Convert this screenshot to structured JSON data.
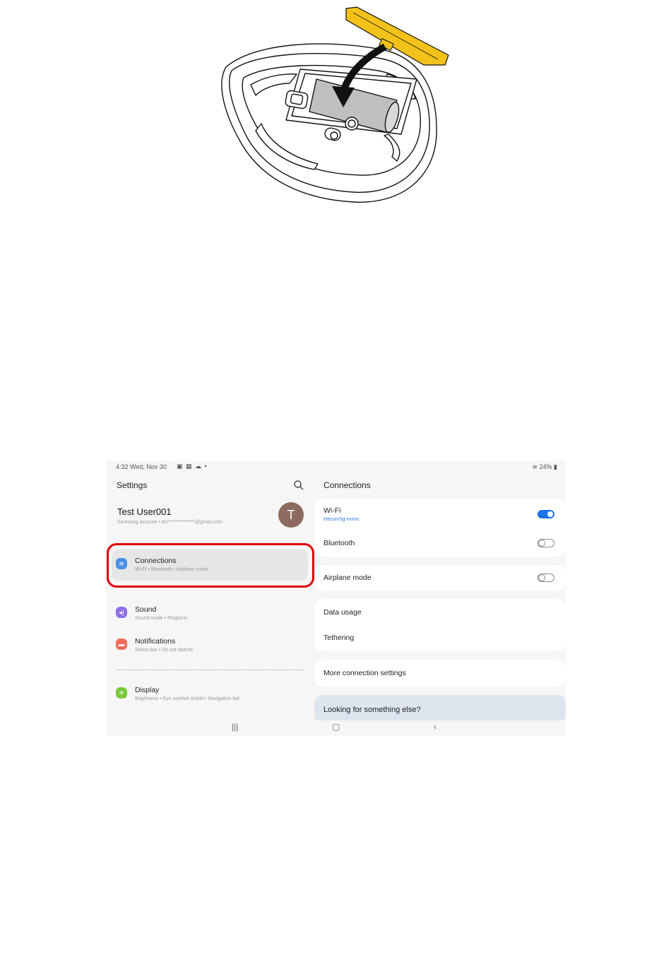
{
  "illustration": {
    "description_icon": "mouse-battery-install-illustration",
    "colors": {
      "cover": "#f2c21b",
      "battery": "#bfbfbf",
      "outline": "#111111"
    }
  },
  "statusbar": {
    "time": "4:32  Wed, Nov 30",
    "right": "24%"
  },
  "settings": {
    "title": "Settings",
    "account": {
      "name": "Test User001",
      "email": "Samsung account  •  tes**************@gmail.com",
      "avatar_letter": "T"
    },
    "menu": [
      {
        "label": "Connections",
        "sub": "Wi-Fi  •  Bluetooth  •  Airplane mode",
        "icon": "wifi-icon",
        "color": "#4a90e2",
        "active": true
      },
      {
        "label": "Sound",
        "sub": "Sound mode  •  Ringtone",
        "icon": "speaker-icon",
        "color": "#8c6ee6",
        "active": false
      },
      {
        "label": "Notifications",
        "sub": "Status bar  •  Do not disturb",
        "icon": "bell-icon",
        "color": "#f06b5e",
        "active": false
      },
      {
        "label": "Display",
        "sub": "Brightness  •  Eye comfort shield  •  Navigation bar",
        "icon": "sun-icon",
        "color": "#7cc93b",
        "active": false
      }
    ]
  },
  "connections": {
    "title": "Connections",
    "wifi": {
      "label": "Wi-Fi",
      "network": "elecom5g-xxxxx",
      "enabled": true
    },
    "bluetooth": {
      "label": "Bluetooth",
      "enabled": false
    },
    "airplane": {
      "label": "Airplane mode",
      "enabled": false
    },
    "data_usage": "Data usage",
    "tethering": "Tethering",
    "more": "More connection settings",
    "looking": "Looking for something else?"
  },
  "highlight_color": "#e00000",
  "accent": "#1a73e8"
}
